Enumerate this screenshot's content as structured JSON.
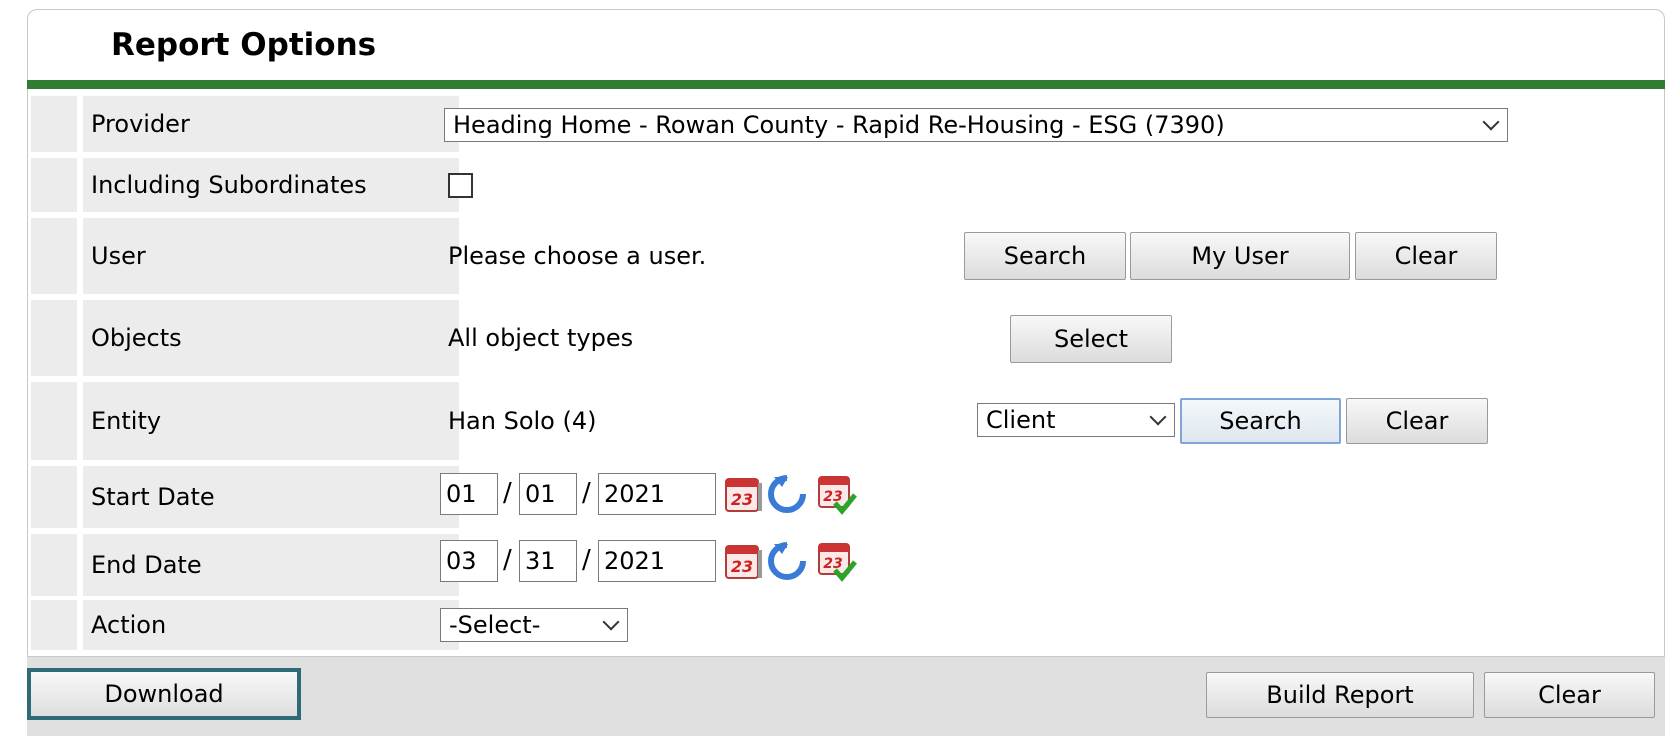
{
  "panel": {
    "title": "Report Options"
  },
  "rows": {
    "provider": {
      "label": "Provider",
      "value": "Heading Home - Rowan County - Rapid Re-Housing - ESG (7390)"
    },
    "including_subordinates": {
      "label": "Including Subordinates",
      "checked": false
    },
    "user": {
      "label": "User",
      "value": "Please choose a user.",
      "search": "Search",
      "my_user": "My User",
      "clear": "Clear"
    },
    "objects": {
      "label": "Objects",
      "value": "All object types",
      "select": "Select"
    },
    "entity": {
      "label": "Entity",
      "value": "Han Solo (4)",
      "type_value": "Client",
      "search": "Search",
      "clear": "Clear"
    },
    "start_date": {
      "label": "Start Date",
      "month": "01",
      "day": "01",
      "year": "2021",
      "sep": "/"
    },
    "end_date": {
      "label": "End Date",
      "month": "03",
      "day": "31",
      "year": "2021",
      "sep": "/"
    },
    "action": {
      "label": "Action",
      "value": "-Select-"
    }
  },
  "footer": {
    "download": "Download",
    "build_report": "Build Report",
    "clear": "Clear"
  },
  "colors": {
    "accent_green": "#2e7d32",
    "download_border": "#2f6b76",
    "label_bg": "#ececec"
  },
  "icons": {
    "calendar": "calendar-icon",
    "reset": "refresh-icon",
    "today": "calendar-check-icon"
  }
}
